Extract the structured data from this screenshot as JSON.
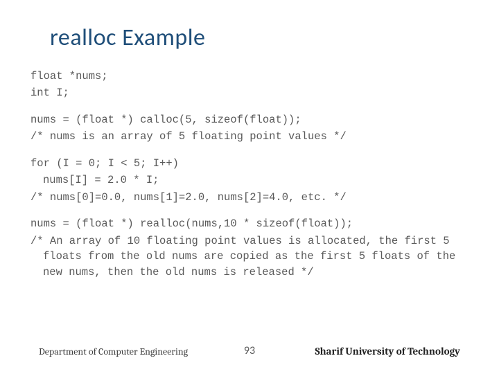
{
  "title": "realloc Example",
  "code": {
    "l1": "float *nums;",
    "l2": "int I;",
    "l3": "nums = (float *) calloc(5, sizeof(float));",
    "l4": "/* nums is an array of 5 floating point values */",
    "l5": "for (I = 0; I < 5; I++)",
    "l6": "nums[I] = 2.0 * I;",
    "l7": "/* nums[0]=0.0, nums[1]=2.0, nums[2]=4.0, etc. */",
    "l8": "nums = (float *) realloc(nums,10 * sizeof(float));",
    "l9": "/* An array of 10 floating point values is allocated, the first 5 floats from the old nums are copied as the first 5 floats of the new nums, then the old nums is released */"
  },
  "footer": {
    "department": "Department of Computer Engineering",
    "page": "93",
    "university": "Sharif University of Technology"
  }
}
